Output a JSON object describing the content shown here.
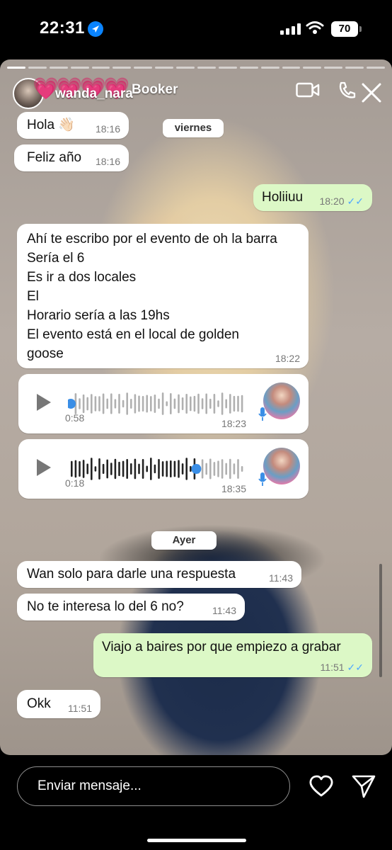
{
  "status_bar": {
    "time": "22:31",
    "battery": "70"
  },
  "story": {
    "username": "wanda_nara",
    "chat_contact": "Booker",
    "progress_segments": 18,
    "progress_active": 1
  },
  "chat": {
    "day_labels": {
      "viernes": "viernes",
      "ayer": "Ayer"
    },
    "messages": [
      {
        "id": "m1",
        "dir": "in",
        "text": "Hola 👋🏻",
        "time": "18:16"
      },
      {
        "id": "m2",
        "dir": "in",
        "text": "Feliz año",
        "time": "18:16"
      },
      {
        "id": "m3",
        "dir": "out",
        "text": "Holiiuu",
        "time": "18:20",
        "read": true
      },
      {
        "id": "m4",
        "dir": "in",
        "text": "Ahí te escribo por el evento de oh la barra\nSería el 6\nEs ir a dos locales\nEl\nHorario sería a las 19hs\nEl evento está en el local de golden\ngoose",
        "time": "18:22"
      },
      {
        "id": "v1",
        "dir": "in",
        "type": "voice",
        "duration": "0:58",
        "time": "18:23",
        "played_fraction": 0.0
      },
      {
        "id": "v2",
        "dir": "in",
        "type": "voice",
        "duration": "0:18",
        "time": "18:35",
        "played_fraction": 0.72
      },
      {
        "id": "m5",
        "dir": "in",
        "text": "Wan solo para darle una respuesta",
        "time": "11:43"
      },
      {
        "id": "m6",
        "dir": "in",
        "text": "No te interesa lo del 6 no?",
        "time": "11:43"
      },
      {
        "id": "m7",
        "dir": "out",
        "text": "Viajo a baires por que empiezo a grabar",
        "time": "11:51",
        "read": true
      },
      {
        "id": "m8",
        "dir": "in",
        "text": "Okk",
        "time": "11:51"
      }
    ]
  },
  "composer": {
    "placeholder": "Enviar mensaje..."
  },
  "icons": {
    "location": "location-arrow-icon",
    "video": "video-call-icon",
    "phone": "phone-icon",
    "close": "close-icon",
    "like": "heart-icon",
    "send": "send-icon"
  },
  "colors": {
    "incoming_bubble": "#ffffff",
    "outgoing_bubble": "#dcf8c6",
    "read_ticks": "#4fa8ff",
    "hearts": "#ff3fa6"
  }
}
